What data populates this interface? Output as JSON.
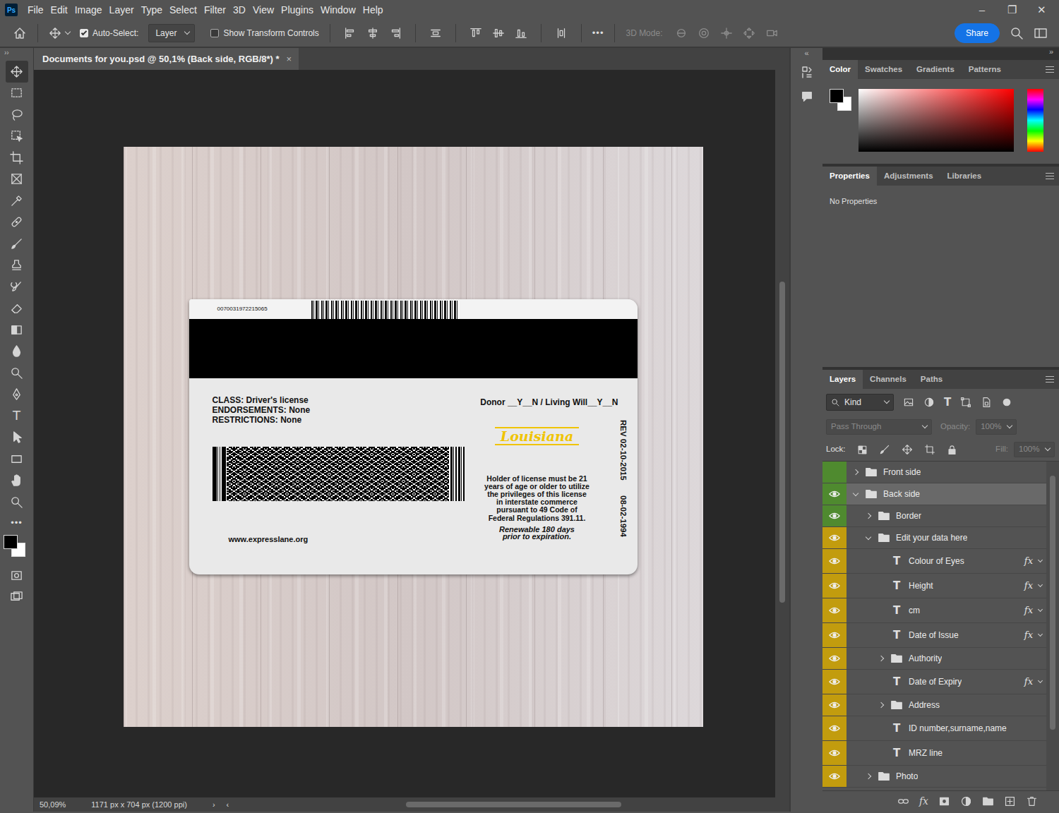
{
  "app": {
    "logo": "Ps"
  },
  "menu": [
    "File",
    "Edit",
    "Image",
    "Layer",
    "Type",
    "Select",
    "Filter",
    "3D",
    "View",
    "Plugins",
    "Window",
    "Help"
  ],
  "window_controls": [
    "–",
    "❐",
    "✕"
  ],
  "options": {
    "auto_select": {
      "label": "Auto-Select:",
      "checked": true
    },
    "target": "Layer",
    "transform_controls": {
      "label": "Show Transform Controls",
      "checked": false
    },
    "more": "•••",
    "mode_label": "3D Mode:",
    "share": "Share"
  },
  "toolbar": {
    "toggle": "››",
    "tools": [
      {
        "selected": true
      },
      {
        "selected": false
      },
      {
        "selected": false
      },
      {
        "selected": false
      },
      {
        "selected": false
      },
      {
        "selected": false
      },
      {
        "selected": false
      },
      {
        "selected": false
      },
      {
        "selected": false
      },
      {
        "selected": false
      },
      {
        "selected": false
      },
      {
        "selected": false
      },
      {
        "selected": false
      },
      {
        "selected": false
      },
      {
        "selected": false
      },
      {
        "selected": false
      },
      {
        "selected": false,
        "glyph": "T"
      },
      {
        "selected": false
      },
      {
        "selected": false
      },
      {
        "selected": false
      },
      {
        "selected": false
      }
    ],
    "more": "•••"
  },
  "document": {
    "tab": "Documents for you.psd @ 50,1% (Back side, RGB/8*) *",
    "close": "×"
  },
  "card": {
    "number": "0070031972215065",
    "class_lines": [
      "CLASS: Driver's license",
      "ENDORSEMENTS: None",
      "RESTRICTIONS: None"
    ],
    "donor": "Donor __Y__N / Living Will__Y__N",
    "state": "Louisiana",
    "notice": [
      "Holder of license must be 21",
      "years of age or older to utilize",
      "the privileges of this license",
      "in interstate commerce",
      "pursuant to 49 Code of",
      "Federal Regulations 391.11."
    ],
    "renewal": [
      "Renewable 180 days",
      "prior to expiration."
    ],
    "website": "www.expresslane.org",
    "rev": "REV 02-10-2015",
    "date": "08-02-1994"
  },
  "status_bar": {
    "zoom": "50,09%",
    "info": "1171 px x 704 px (1200 ppi)",
    "more": "›",
    "left": "‹"
  },
  "dock": {
    "toggles": [
      "«",
      "»"
    ]
  },
  "panels": {
    "color": {
      "tabs": [
        {
          "label": "Color",
          "selected": true
        },
        {
          "label": "Swatches",
          "selected": false
        },
        {
          "label": "Gradients",
          "selected": false
        },
        {
          "label": "Patterns",
          "selected": false
        }
      ],
      "foreground": "#000000",
      "background": "#ffffff"
    },
    "properties": {
      "tabs": [
        {
          "label": "Properties",
          "selected": true
        },
        {
          "label": "Adjustments",
          "selected": false
        },
        {
          "label": "Libraries",
          "selected": false
        }
      ],
      "message": "No Properties"
    },
    "layers": {
      "tabs": [
        {
          "label": "Layers",
          "selected": true
        },
        {
          "label": "Channels",
          "selected": false
        },
        {
          "label": "Paths",
          "selected": false
        }
      ],
      "filter": {
        "label": "Kind",
        "glyph": "T"
      },
      "blend": {
        "label": "Pass Through",
        "disabled": true
      },
      "opacity": {
        "label": "Opacity:",
        "value": "100%",
        "disabled": true
      },
      "lock_label": "Lock:",
      "fill": {
        "label": "Fill:",
        "value": "100%",
        "disabled": true
      },
      "items": [
        {
          "name": "Front side",
          "kind": "group",
          "visible": false,
          "expanded": false,
          "selected": false,
          "color": "#4f8a2f"
        },
        {
          "name": "Back side",
          "kind": "group",
          "visible": true,
          "expanded": true,
          "selected": true,
          "color": "#4f8a2f",
          "children": [
            {
              "name": "Border",
              "kind": "group",
              "visible": true,
              "expanded": false,
              "selected": false,
              "color": "#4f8a2f"
            },
            {
              "name": "Edit your data here",
              "kind": "group",
              "visible": true,
              "expanded": true,
              "selected": false,
              "color": "#c29c0e",
              "children": [
                {
                  "name": "Colour of Eyes",
                  "kind": "text",
                  "glyph": "T",
                  "fx": "fx",
                  "visible": true,
                  "selected": false,
                  "color": "#c29c0e"
                },
                {
                  "name": "Height",
                  "kind": "text",
                  "glyph": "T",
                  "fx": "fx",
                  "visible": true,
                  "selected": false,
                  "color": "#c29c0e"
                },
                {
                  "name": "cm",
                  "kind": "text",
                  "glyph": "T",
                  "fx": "fx",
                  "visible": true,
                  "selected": false,
                  "color": "#c29c0e"
                },
                {
                  "name": "Date of Issue",
                  "kind": "text",
                  "glyph": "T",
                  "fx": "fx",
                  "visible": true,
                  "selected": false,
                  "color": "#c29c0e"
                },
                {
                  "name": "Authority",
                  "kind": "group",
                  "visible": true,
                  "expanded": false,
                  "selected": false,
                  "color": "#c29c0e"
                },
                {
                  "name": "Date of Expiry",
                  "kind": "text",
                  "glyph": "T",
                  "fx": "fx",
                  "visible": true,
                  "selected": false,
                  "color": "#c29c0e"
                },
                {
                  "name": "Address",
                  "kind": "group",
                  "visible": true,
                  "expanded": false,
                  "selected": false,
                  "color": "#c29c0e"
                },
                {
                  "name": "ID number,surname,name",
                  "kind": "text",
                  "glyph": "T",
                  "visible": true,
                  "selected": false,
                  "color": "#c29c0e"
                },
                {
                  "name": "MRZ line",
                  "kind": "text",
                  "glyph": "T",
                  "visible": true,
                  "selected": false,
                  "color": "#c29c0e"
                }
              ]
            },
            {
              "name": "Photo",
              "kind": "group",
              "visible": true,
              "expanded": false,
              "selected": false,
              "color": "#c29c0e"
            }
          ]
        }
      ],
      "footer_fx": "fx"
    }
  }
}
